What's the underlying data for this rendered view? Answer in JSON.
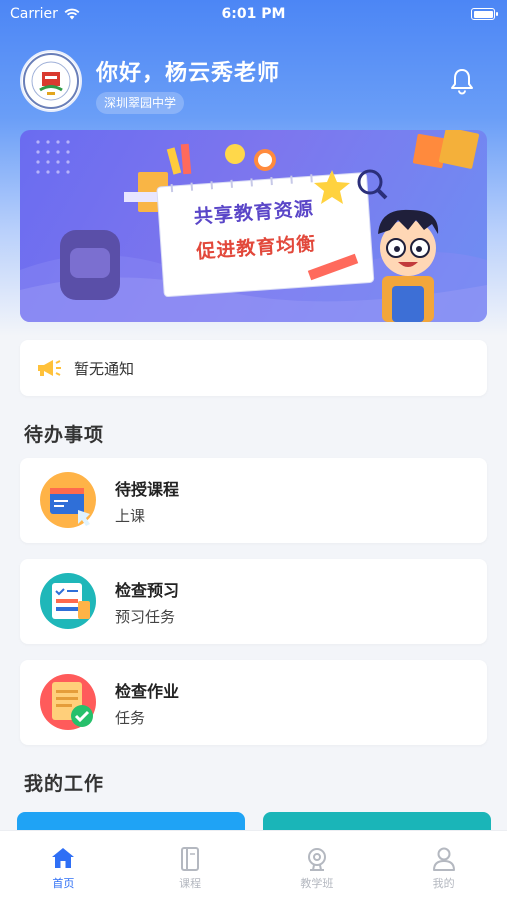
{
  "status_bar": {
    "carrier": "Carrier",
    "time": "6:01 PM"
  },
  "header": {
    "greeting": "你好，杨云秀老师",
    "school": "深圳翠园中学"
  },
  "banner": {
    "line1": "共享教育资源",
    "line2": "促进教育均衡"
  },
  "notice": {
    "text": "暂无通知"
  },
  "todo": {
    "title": "待办事项",
    "items": [
      {
        "title": "待授课程",
        "subtitle": "上课",
        "icon": "book-icon"
      },
      {
        "title": "检查预习",
        "subtitle": "预习任务",
        "icon": "preview-checklist-icon"
      },
      {
        "title": "检查作业",
        "subtitle": "任务",
        "icon": "homework-check-icon"
      }
    ]
  },
  "my_work": {
    "title": "我的工作"
  },
  "tabs": [
    {
      "label": "首页",
      "icon": "home-icon",
      "active": true
    },
    {
      "label": "课程",
      "icon": "course-book-icon",
      "active": false
    },
    {
      "label": "教学班",
      "icon": "class-icon",
      "active": false
    },
    {
      "label": "我的",
      "icon": "profile-icon",
      "active": false
    }
  ],
  "colors": {
    "primary": "#2f6ff5",
    "banner": "#6f73ef",
    "work_card_1": "#1fa3f5",
    "work_card_2": "#1ab5b8"
  }
}
